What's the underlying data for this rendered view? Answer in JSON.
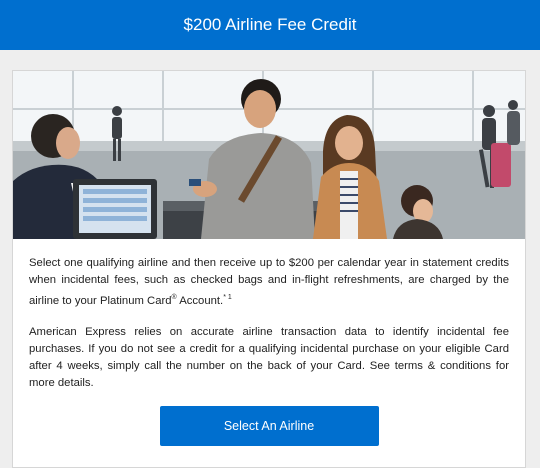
{
  "header": {
    "title": "$200 Airline Fee Credit"
  },
  "benefit": {
    "para1_main": "Select one qualifying airline and then receive up to $200 per calendar year in statement credits when incidental fees, such as checked bags and in-flight refreshments, are charged by the airline to your Platinum Card",
    "para1_reg": "®",
    "para1_end": " Account.",
    "para1_note": "* 1",
    "para2": "American Express relies on accurate airline transaction data to identify incidental fee purchases. If you do not see a credit for a qualifying incidental purchase on your eligible Card after 4 weeks, simply call the number on the back of your Card. See terms & conditions for more details.",
    "button_label": "Select An Airline"
  },
  "colors": {
    "brand_blue": "#006fcf",
    "page_bg": "#eeeeee",
    "card_bg": "#ffffff"
  }
}
